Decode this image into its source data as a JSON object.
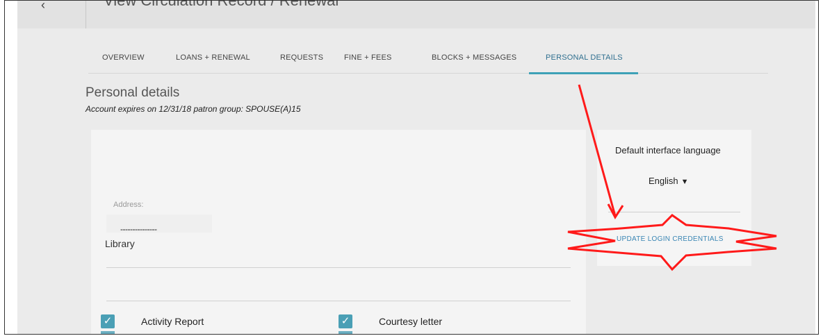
{
  "header": {
    "back_icon": "chevron-left-icon",
    "title": "View Circulation Record / Renewal"
  },
  "tabs": [
    {
      "label": "OVERVIEW",
      "active": false
    },
    {
      "label": "LOANS + RENEWAL",
      "active": false
    },
    {
      "label": "REQUESTS",
      "active": false
    },
    {
      "label": "FINE + FEES",
      "active": false
    },
    {
      "label": "BLOCKS + MESSAGES",
      "active": false
    },
    {
      "label": "PERSONAL DETAILS",
      "active": true
    }
  ],
  "personal": {
    "title": "Personal details",
    "subtitle": "Account expires on 12/31/18 patron group: SPOUSE(A)15",
    "address_label": "Address:",
    "address_line": "---------------",
    "address_value": "Library"
  },
  "checkboxes": [
    {
      "label": "Activity Report",
      "checked": true
    },
    {
      "label": "Courtesy letter",
      "checked": true
    }
  ],
  "side_panel": {
    "language_label": "Default interface language",
    "language_value": "English",
    "update_link": "UPDATE LOGIN CREDENTIALS"
  },
  "colors": {
    "accent": "#3da1b7",
    "annotation": "#ff1a1a",
    "link": "#3a86b4"
  }
}
